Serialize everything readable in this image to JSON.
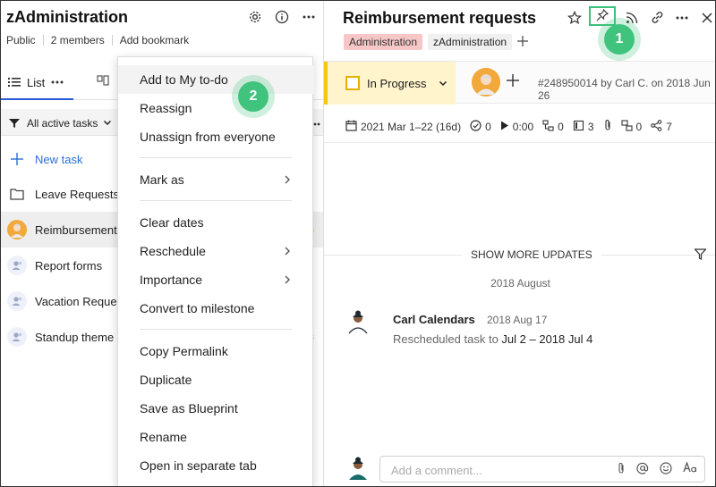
{
  "left": {
    "title": "zAdministration",
    "meta": [
      "Public",
      "2 members",
      "Add bookmark"
    ],
    "view_tab": "List",
    "filter": "All active tasks",
    "new_task": "New task",
    "rows": [
      {
        "label": "Leave Requests",
        "icon": "folder-icon"
      },
      {
        "label": "Reimbursement",
        "icon": "avatar"
      },
      {
        "label": "Report forms",
        "icon": "users-icon"
      },
      {
        "label": "Vacation Reque",
        "icon": "users-icon"
      },
      {
        "label": "Standup theme",
        "icon": "users-icon"
      }
    ]
  },
  "menu": {
    "items": [
      {
        "label": "Add to My to-do"
      },
      {
        "label": "Reassign"
      },
      {
        "label": "Unassign from everyone"
      },
      {
        "label": "Mark as",
        "submenu": true
      },
      {
        "label": "Clear dates"
      },
      {
        "label": "Reschedule",
        "submenu": true
      },
      {
        "label": "Importance",
        "submenu": true
      },
      {
        "label": "Convert to milestone"
      },
      {
        "label": "Copy Permalink"
      },
      {
        "label": "Duplicate"
      },
      {
        "label": "Save as Blueprint"
      },
      {
        "label": "Rename"
      },
      {
        "label": "Open in separate tab"
      }
    ]
  },
  "task": {
    "title": "Reimbursement requests",
    "tags": [
      "Administration",
      "zAdministration"
    ],
    "status": "In Progress",
    "task_id": "#248950014 by Carl C. on 2018 Jun 26",
    "dates": "2021 Mar 1–22 (16d)",
    "subtasks": "0",
    "time": "0:00",
    "dependencies": "0",
    "notes": "3",
    "links": "0",
    "shares": "7"
  },
  "updates": {
    "show_more": "SHOW MORE UPDATES",
    "date_header": "2018 August",
    "entries": [
      {
        "author": "Carl Calendars",
        "date": "2018 Aug 17",
        "action": "Rescheduled task to",
        "value": "Jul 2 – 2018 Jul 4"
      }
    ]
  },
  "composer": {
    "placeholder": "Add a comment..."
  },
  "badges": [
    "1",
    "2"
  ],
  "colors": {
    "accent": "#2a5bd7",
    "step_badge": "#3fc37d",
    "status": "#f5c518",
    "tag_admin": "#f7c7c7"
  }
}
